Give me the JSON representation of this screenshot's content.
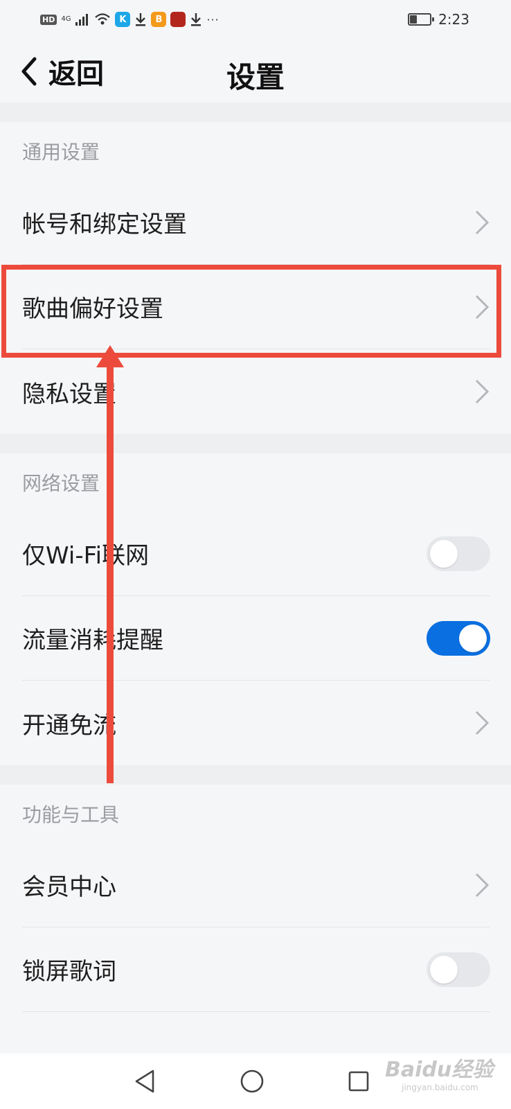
{
  "status_bar": {
    "hd_badge": "HD",
    "network": "4G",
    "app_badge_k": "K",
    "app_badge_b": "B",
    "more": "···",
    "battery_level": 0.35,
    "time": "2:23"
  },
  "header": {
    "back_label": "返回",
    "title": "设置"
  },
  "groups": [
    {
      "title": "通用设置",
      "items": [
        {
          "label": "帐号和绑定设置",
          "control": "chevron"
        },
        {
          "label": "歌曲偏好设置",
          "control": "chevron"
        },
        {
          "label": "隐私设置",
          "control": "chevron"
        }
      ]
    },
    {
      "title": "网络设置",
      "items": [
        {
          "label": "仅Wi-Fi联网",
          "control": "toggle",
          "on": false
        },
        {
          "label": "流量消耗提醒",
          "control": "toggle",
          "on": true
        },
        {
          "label": "开通免流",
          "control": "chevron"
        }
      ]
    },
    {
      "title": "功能与工具",
      "items": [
        {
          "label": "会员中心",
          "control": "chevron"
        },
        {
          "label": "锁屏歌词",
          "control": "toggle",
          "on": false
        }
      ]
    }
  ],
  "colors": {
    "accent": "#0a6fe0",
    "annotation": "#ec4b3c"
  },
  "watermark": {
    "main": "Baidu经验",
    "sub": "jingyan.baidu.com"
  }
}
